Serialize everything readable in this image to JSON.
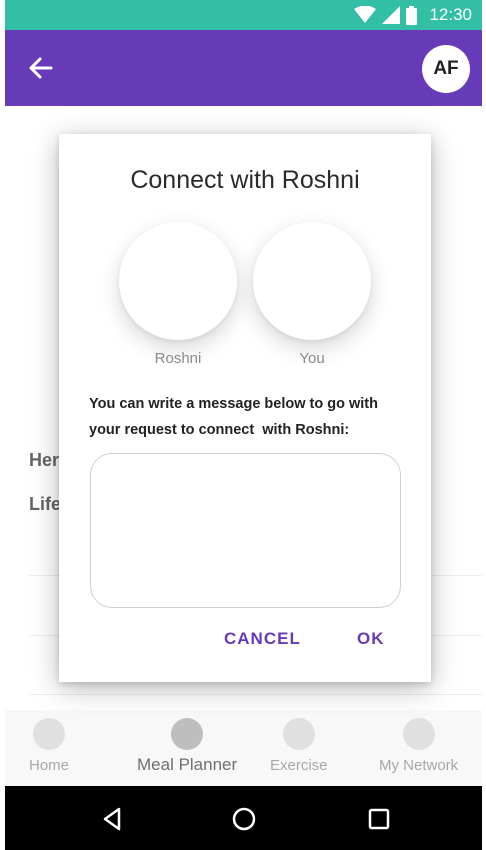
{
  "status_bar": {
    "time": "12:30",
    "color": "#33bfa6"
  },
  "app_bar": {
    "back_icon": "arrow-left-icon",
    "avatar_initials": "AF",
    "color": "#673ab7"
  },
  "background": {
    "line1": "Her",
    "line2": "Life"
  },
  "dialog": {
    "title": "Connect with Roshni",
    "person1": "Roshni",
    "person2": "You",
    "message_line1": "You can write a message below to go with",
    "message_line2": "your request to connect  with Roshni:",
    "message_value": "",
    "cancel_label": "CANCEL",
    "ok_label": "OK",
    "accent": "#673ab7"
  },
  "bottom_nav": {
    "items": [
      {
        "label": "Home",
        "active": false
      },
      {
        "label": "Meal Planner",
        "active": true
      },
      {
        "label": "Exercise",
        "active": false
      },
      {
        "label": "My Network",
        "active": false
      }
    ]
  },
  "system_nav": {
    "icons": [
      "back-triangle-icon",
      "home-circle-icon",
      "recents-square-icon"
    ]
  }
}
